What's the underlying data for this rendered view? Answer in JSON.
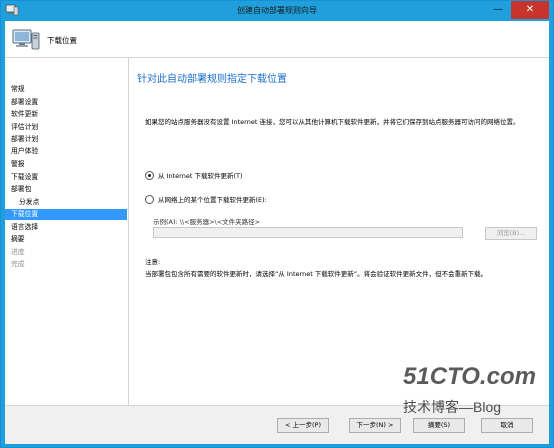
{
  "window": {
    "title": "创建自动部署规则向导",
    "minimize_glyph": "—",
    "close_glyph": "✕"
  },
  "header": {
    "title": "下载位置",
    "icon": "computer-icon"
  },
  "sidebar": {
    "items": [
      {
        "label": "常规",
        "state": "normal"
      },
      {
        "label": "部署设置",
        "state": "normal"
      },
      {
        "label": "软件更新",
        "state": "normal"
      },
      {
        "label": "评估计划",
        "state": "normal"
      },
      {
        "label": "部署计划",
        "state": "normal"
      },
      {
        "label": "用户体验",
        "state": "normal"
      },
      {
        "label": "警报",
        "state": "normal"
      },
      {
        "label": "下载设置",
        "state": "normal"
      },
      {
        "label": "部署包",
        "state": "normal"
      },
      {
        "label": "分发点",
        "state": "sub"
      },
      {
        "label": "下载位置",
        "state": "active"
      },
      {
        "label": "语言选择",
        "state": "normal"
      },
      {
        "label": "摘要",
        "state": "normal"
      },
      {
        "label": "进度",
        "state": "disabled"
      },
      {
        "label": "完成",
        "state": "disabled"
      }
    ]
  },
  "main": {
    "heading": "针对此自动部署规则指定下载位置",
    "description": "如果您的站点服务器没有设置 Internet 连接，您可以从其他计算机下载软件更新，并将它们保存到站点服务器可访问的网络位置。",
    "option_internet": "从 Internet 下载软件更新(T)",
    "option_network": "从网络上的某个位置下载软件更新(E):",
    "example": "示例(A): \\\\<服务器>\\<文件夹路径>",
    "path_value": "",
    "browse_label": "浏览(B)...",
    "note_label": "注意:",
    "note_text": "当部署包包含所有需要的软件更新时，请选择“从 Internet 下载软件更新”。将会验证软件更新文件，但不会重新下载。",
    "selected_option": "internet"
  },
  "footer": {
    "prev_label": "< 上一步(P)",
    "next_label": "下一步(N) >",
    "summary_label": "摘要(S)",
    "cancel_label": "取消"
  },
  "watermark": {
    "site": "51CTO.com",
    "blog": "技术博客—Blog"
  },
  "colors": {
    "accent": "#1c6fc8",
    "selection": "#3399ff",
    "titlebar": "#1fa0dc",
    "close": "#c7342c"
  }
}
